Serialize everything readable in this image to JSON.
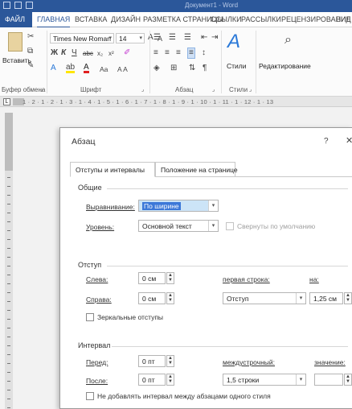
{
  "window": {
    "doc_title": "Документ1 - Word"
  },
  "ribbon_tabs": [
    {
      "label": "ФАЙЛ"
    },
    {
      "label": "ГЛАВНАЯ"
    },
    {
      "label": "ВСТАВКА"
    },
    {
      "label": "ДИЗАЙН"
    },
    {
      "label": "РАЗМЕТКА СТРАНИЦЫ"
    },
    {
      "label": "ССЫЛКИ"
    },
    {
      "label": "РАССЫЛКИ"
    },
    {
      "label": "РЕЦЕНЗИРОВАНИЕ"
    },
    {
      "label": "ВИД"
    }
  ],
  "ribbon": {
    "paste_label": "Вставить",
    "font_name": "Times New Roman",
    "font_size": "14",
    "styles_label": "Стили",
    "editing_label": "Редактирование",
    "groups": {
      "clipboard": "Буфер обмена",
      "font": "Шрифт",
      "paragraph": "Абзац",
      "styles": "Стили"
    },
    "font_buttons": {
      "bold": "Ж",
      "italic": "К",
      "underline": "Ч",
      "strike": "abc",
      "sub": "x₂",
      "sup": "x²"
    }
  },
  "ruler": {
    "ticks": "1 · 2 · 1 · 2 · 1 · 3 · 1 · 4 · 1 · 5 · 1 · 6 · 1 · 7 · 1 · 8 · 1 · 9 · 1 · 10 · 1 · 11 · 1 · 12 · 1 · 13"
  },
  "dialog": {
    "title": "Абзац",
    "help": "?",
    "close": "✕",
    "tabs": [
      {
        "label": "Отступы и интервалы"
      },
      {
        "label": "Положение на странице"
      }
    ],
    "general": {
      "heading": "Общие",
      "alignment_label": "Выравнивание:",
      "alignment_value": "По ширине",
      "level_label": "Уровень:",
      "level_value": "Основной текст",
      "collapsed_label": "Свернуты по умолчанию"
    },
    "indent": {
      "heading": "Отступ",
      "left_label": "Слева:",
      "left_value": "0 см",
      "right_label": "Справа:",
      "right_value": "0 см",
      "first_line_label": "первая строка:",
      "first_line_value": "Отступ",
      "by_label": "на:",
      "by_value": "1,25 см",
      "mirror_label": "Зеркальные отступы"
    },
    "spacing": {
      "heading": "Интервал",
      "before_label": "Перед:",
      "before_value": "0 пт",
      "after_label": "После:",
      "after_value": "0 пт",
      "line_spacing_label": "междустрочный:",
      "line_spacing_value": "1,5 строки",
      "value_label": "значение:",
      "value_value": "",
      "no_space_label": "Не добавлять интервал между абзацами одного стиля"
    }
  }
}
